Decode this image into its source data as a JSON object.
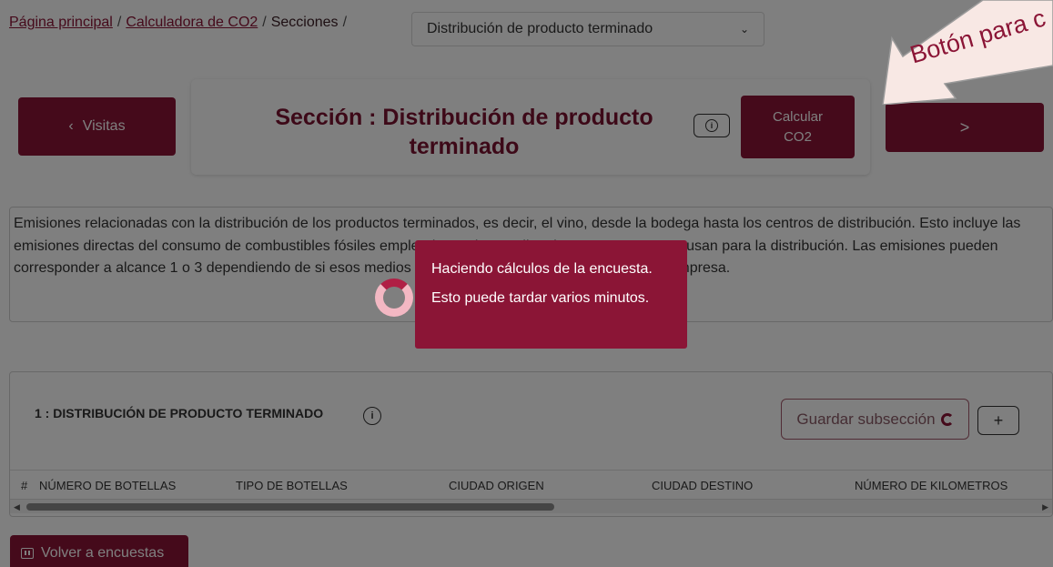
{
  "breadcrumb": {
    "home": "Página principal",
    "calculator": "Calculadora de CO2",
    "sections": "Secciones",
    "separator": "/"
  },
  "section_select": {
    "value": "Distribución de producto terminado"
  },
  "header": {
    "prev_label": "Visitas",
    "title": "Sección : Distribución de producto terminado",
    "calc_label_1": "Calcular",
    "calc_label_2": "CO2",
    "next_label": ">"
  },
  "description": "Emisiones relacionadas con la distribución de los productos terminados, es decir, el vino, desde la bodega hasta los centros de distribución. Esto incluye las emisiones directas del consumo de combustibles fósiles empleados en los medios de transporte que se usan para la distribución. Las emisiones pueden corresponder a alcance 1 o 3 dependiendo de si esos medios de transporte son propiedad o no de la empresa.",
  "subsection": {
    "title": "1 : DISTRIBUCIÓN DE PRODUCTO TERMINADO",
    "save_label": "Guardar subsección",
    "add_label": "+",
    "columns": [
      "#",
      "NÚMERO DE BOTELLAS",
      "TIPO DE BOTELLAS",
      "CIUDAD ORIGEN",
      "CIUDAD DESTINO",
      "NÚMERO DE KILOMETROS"
    ]
  },
  "back_button": "Volver a encuestas",
  "toast": {
    "line1": "Haciendo cálculos de la encuesta.",
    "line2": "Esto puede tardar varios minutos."
  },
  "annotation": {
    "text": "Botón para c"
  },
  "colors": {
    "accent": "#8b1536",
    "annotation_arrow": "#f8e8e4"
  },
  "icons": {
    "info": "info-icon",
    "spinner": "loading-spinner-icon",
    "back": "list-icon"
  }
}
